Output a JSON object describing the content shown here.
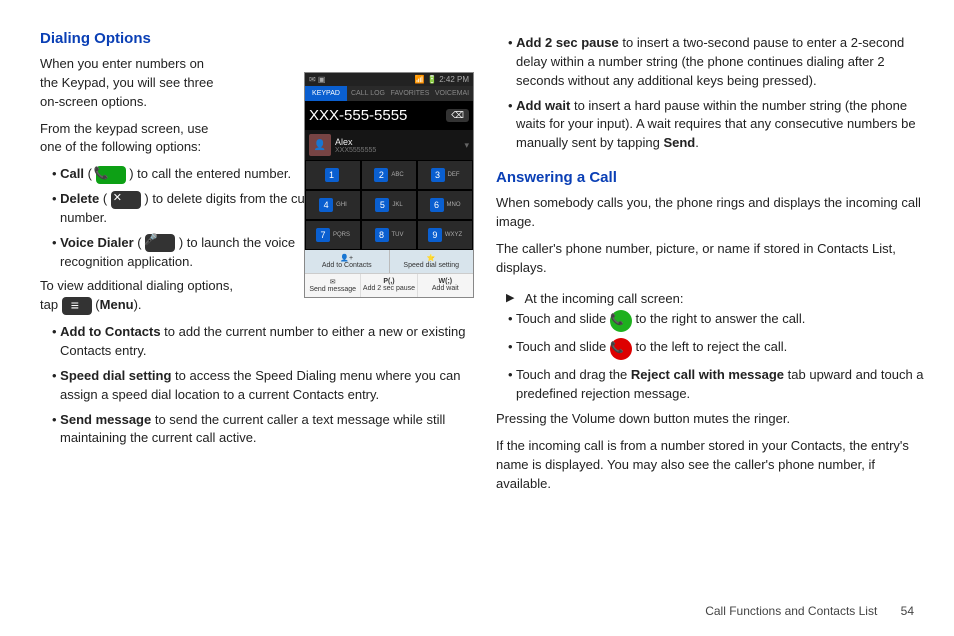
{
  "left": {
    "heading": "Dialing Options",
    "intro1": "When you enter numbers on the Keypad, you will see three on-screen options.",
    "intro2": "From the keypad screen, use one of the following options:",
    "opt_call_a": "Call",
    "opt_call_b": " ( ",
    "opt_call_c": " ) to call the entered number.",
    "opt_del_a": "Delete",
    "opt_del_b": " ( ",
    "opt_del_c": " ) to delete digits from the current number.",
    "opt_vd_a": "Voice Dialer",
    "opt_vd_b": " ( ",
    "opt_vd_c": " ) to launch the voice recognition application.",
    "tap_a": "To view additional dialing options, tap ",
    "tap_b": " (",
    "tap_c": "Menu",
    "tap_d": ").",
    "addc_a": "Add to Contacts",
    "addc_b": " to add the current number to either a new or existing Contacts entry.",
    "sds_a": "Speed dial setting",
    "sds_b": " to access the Speed Dialing menu where you can assign a speed dial location to a current Contacts entry.",
    "sm_a": "Send message",
    "sm_b": " to send the current caller a text message while still maintaining the current call active."
  },
  "right": {
    "a2p_a": "Add 2 sec pause",
    "a2p_b": " to insert a two-second pause to enter a 2-second delay within a number string (the phone continues dialing after 2 seconds without any additional keys being pressed).",
    "aw_a": "Add wait",
    "aw_b": " to insert a hard pause within the number string (the phone waits for your input). A wait requires that any consecutive numbers be manually sent by tapping ",
    "aw_c": "Send",
    "aw_d": ".",
    "heading2": "Answering a Call",
    "p1": "When somebody calls you, the phone rings and displays the incoming call image.",
    "p2": "The caller's phone number, picture, or name if stored in Contacts List, displays.",
    "arrow": "At the incoming call screen:",
    "ans_a": "Touch and slide ",
    "ans_b": " to the right to answer the call.",
    "rej_a": "Touch and slide ",
    "rej_b": " to the left to reject the call.",
    "drag_a": "Touch and drag the ",
    "drag_b": "Reject call with message",
    "drag_c": " tab upward and touch a predefined rejection message.",
    "p3": "Pressing the Volume down button mutes the ringer.",
    "p4": "If the incoming call is from a number stored in your Contacts, the entry's name is displayed. You may also see the caller's phone number, if available."
  },
  "phone": {
    "status_left": "✉ ▣",
    "status_right": "📶 🔋 2:42 PM",
    "tabs": [
      "KEYPAD",
      "CALL LOG",
      "FAVORITES",
      "VOICEMAI"
    ],
    "display": "XXX-555-5555",
    "contact_name": "Alex",
    "contact_num": "XXX5555555",
    "keys": [
      {
        "n": "1",
        "l": ""
      },
      {
        "n": "2",
        "l": "ABC"
      },
      {
        "n": "3",
        "l": "DEF"
      },
      {
        "n": "4",
        "l": "GHI"
      },
      {
        "n": "5",
        "l": "JKL"
      },
      {
        "n": "6",
        "l": "MNO"
      },
      {
        "n": "7",
        "l": "PQRS"
      },
      {
        "n": "8",
        "l": "TUV"
      },
      {
        "n": "9",
        "l": "WXYZ"
      }
    ],
    "action1": "Add to Contacts",
    "action2": "Speed dial setting",
    "menu1": "Send message",
    "menu2_a": "P(,)",
    "menu2_b": "Add 2 sec pause",
    "menu3_a": "W(;)",
    "menu3_b": "Add wait"
  },
  "footer": {
    "section": "Call Functions and Contacts List",
    "page": "54"
  }
}
